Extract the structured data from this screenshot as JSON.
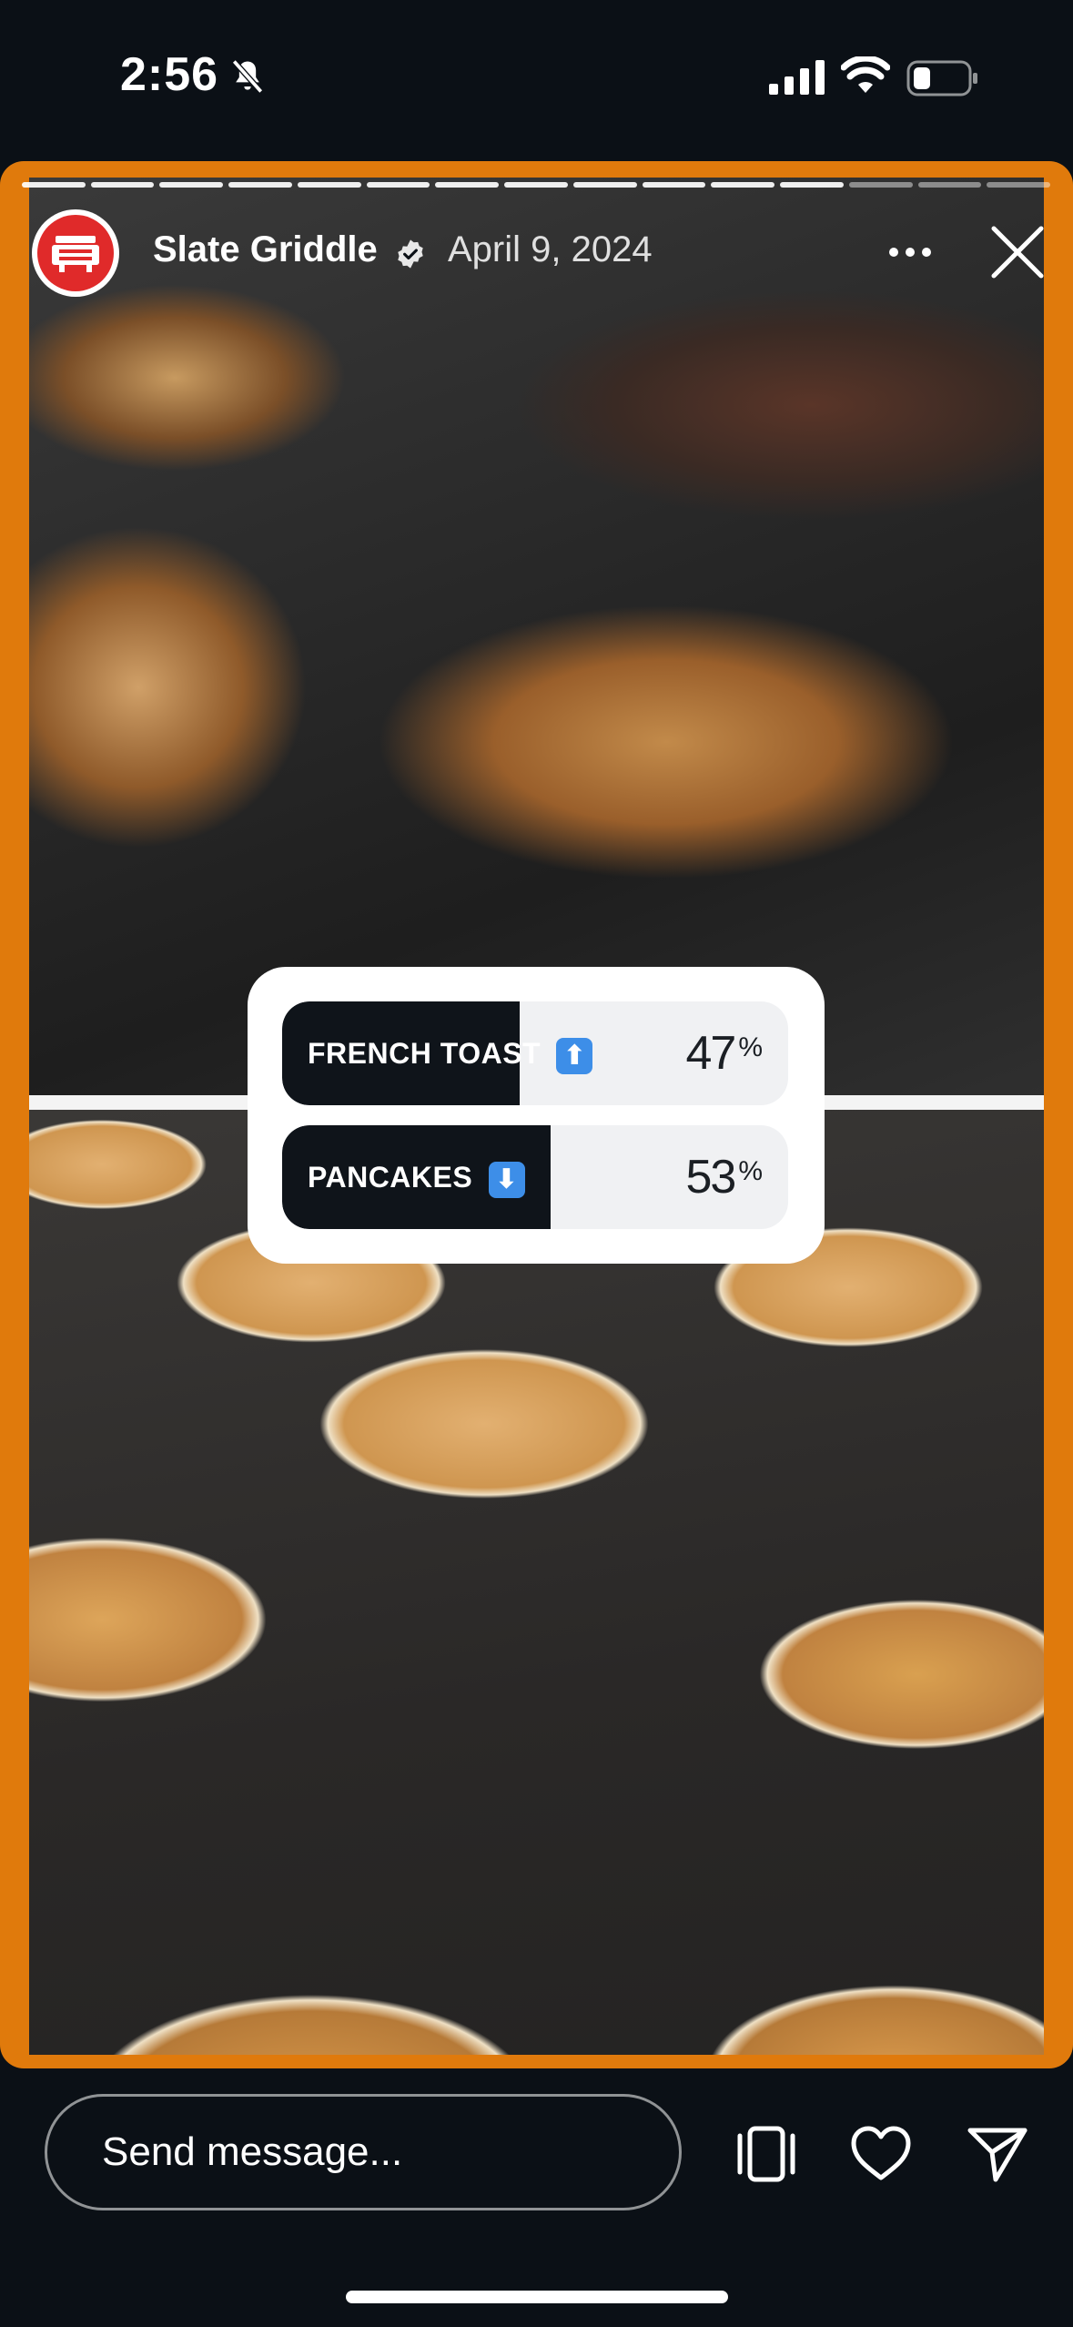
{
  "status_bar": {
    "time": "2:56"
  },
  "story": {
    "account": "Slate Griddle",
    "date": "April 9, 2024",
    "segments_total": 15,
    "segments_completed": 12
  },
  "poll": {
    "options": [
      {
        "label": "FRENCH TOAST",
        "emoji": "⬆",
        "percent": "47",
        "percent_symbol": "%",
        "fill_fraction": 0.47
      },
      {
        "label": "PANCAKES",
        "emoji": "⬇",
        "percent": "53",
        "percent_symbol": "%",
        "fill_fraction": 0.53
      }
    ]
  },
  "composer": {
    "placeholder": "Send message..."
  },
  "icons": {
    "mute": "bell-slash-icon",
    "signal": "cellular-signal-icon",
    "wifi": "wifi-icon",
    "battery": "battery-icon",
    "verified": "verified-badge-icon",
    "more": "more-options-icon",
    "close": "close-icon",
    "carousel": "carousel-icon",
    "like": "heart-icon",
    "share": "send-icon"
  },
  "colors": {
    "frame": "#e07a0c",
    "background": "#0b1016",
    "poll_fill": "#0f141a",
    "avatar_red": "#e02a2a"
  }
}
